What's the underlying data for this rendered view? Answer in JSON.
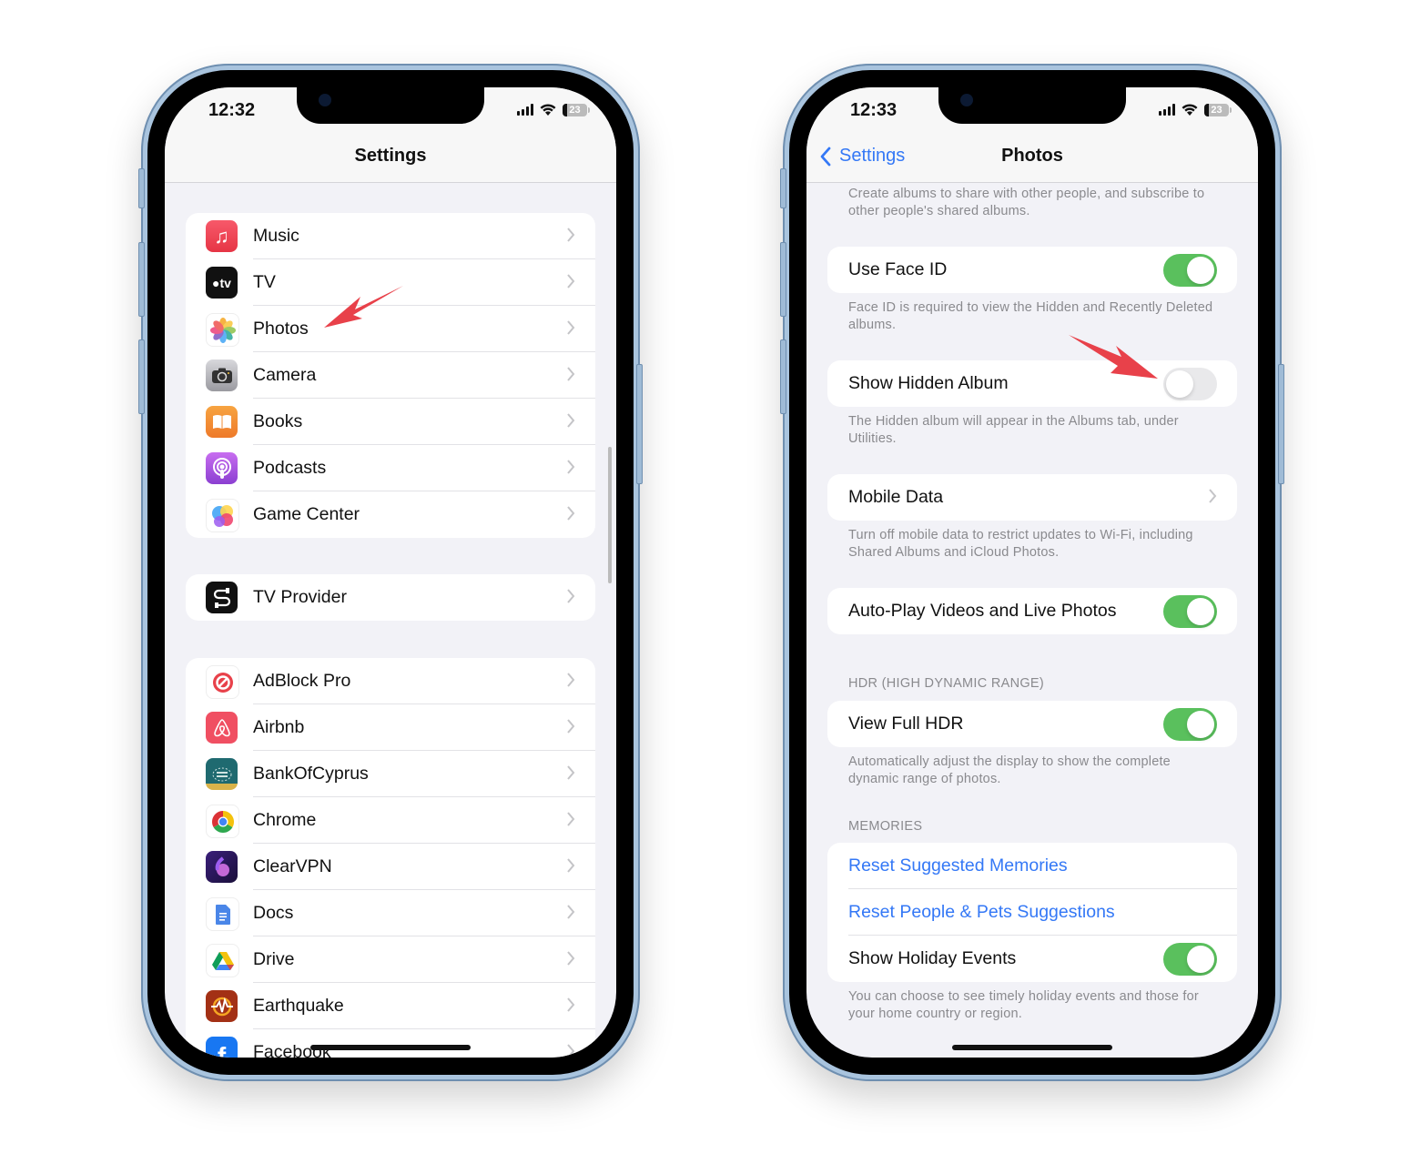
{
  "left_phone": {
    "status": {
      "time": "12:32",
      "battery": "23"
    },
    "nav_title": "Settings",
    "groups": [
      {
        "items": [
          {
            "label": "Music",
            "icon": "music-icon"
          },
          {
            "label": "TV",
            "icon": "apple-tv-icon"
          },
          {
            "label": "Photos",
            "icon": "photos-icon"
          },
          {
            "label": "Camera",
            "icon": "camera-icon"
          },
          {
            "label": "Books",
            "icon": "books-icon"
          },
          {
            "label": "Podcasts",
            "icon": "podcasts-icon"
          },
          {
            "label": "Game Center",
            "icon": "game-center-icon"
          }
        ]
      },
      {
        "items": [
          {
            "label": "TV Provider",
            "icon": "tv-provider-icon"
          }
        ]
      },
      {
        "items": [
          {
            "label": "AdBlock Pro",
            "icon": "adblock-icon"
          },
          {
            "label": "Airbnb",
            "icon": "airbnb-icon"
          },
          {
            "label": "BankOfCyprus",
            "icon": "bank-of-cyprus-icon"
          },
          {
            "label": "Chrome",
            "icon": "chrome-icon"
          },
          {
            "label": "ClearVPN",
            "icon": "clearvpn-icon"
          },
          {
            "label": "Docs",
            "icon": "docs-icon"
          },
          {
            "label": "Drive",
            "icon": "drive-icon"
          },
          {
            "label": "Earthquake",
            "icon": "earthquake-icon"
          },
          {
            "label": "Facebook",
            "icon": "facebook-icon"
          }
        ]
      }
    ]
  },
  "right_phone": {
    "status": {
      "time": "12:33",
      "battery": "23"
    },
    "back_label": "Settings",
    "nav_title": "Photos",
    "top_footer": "Create albums to share with other people, and subscribe to other people's shared albums.",
    "use_face_id": {
      "label": "Use Face ID",
      "on": true,
      "footer": "Face ID is required to view the Hidden and Recently Deleted albums."
    },
    "show_hidden_album": {
      "label": "Show Hidden Album",
      "on": false,
      "footer": "The Hidden album will appear in the Albums tab, under Utilities."
    },
    "mobile_data": {
      "label": "Mobile Data",
      "footer": "Turn off mobile data to restrict updates to Wi-Fi, including Shared Albums and iCloud Photos."
    },
    "autoplay": {
      "label": "Auto-Play Videos and Live Photos",
      "on": true
    },
    "hdr_header": "HDR (HIGH DYNAMIC RANGE)",
    "view_full_hdr": {
      "label": "View Full HDR",
      "on": true,
      "footer": "Automatically adjust the display to show the complete dynamic range of photos."
    },
    "memories_header": "MEMORIES",
    "reset_memories": "Reset Suggested Memories",
    "reset_people": "Reset People & Pets Suggestions",
    "holiday": {
      "label": "Show Holiday Events",
      "on": true,
      "footer": "You can choose to see timely holiday events and those for your home country or region."
    }
  },
  "colors": {
    "accent": "#3478f6",
    "toggle_on": "#5ac05d",
    "annotation_arrow": "#e8414a"
  }
}
